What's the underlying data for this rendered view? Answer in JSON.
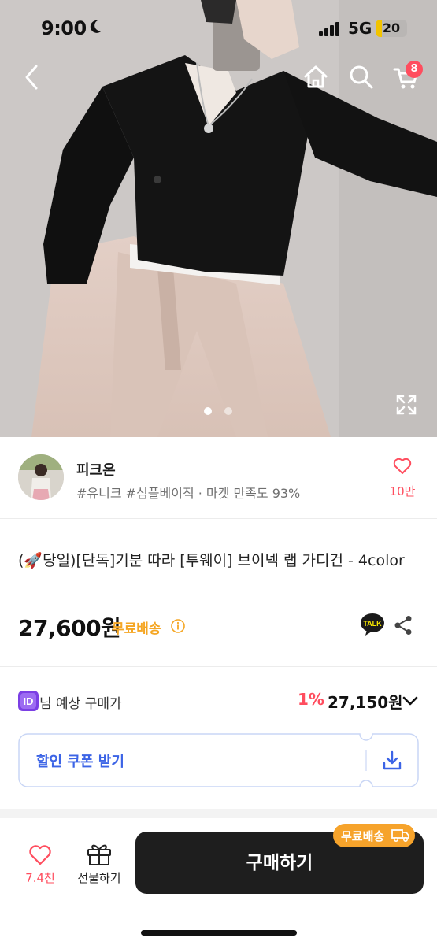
{
  "status_bar": {
    "time": "9:00",
    "network": "5G",
    "battery": "20",
    "battery_level": 0.2
  },
  "top_nav": {
    "cart_badge": "8"
  },
  "gallery": {
    "image_count": 2,
    "active_index": 0
  },
  "seller": {
    "name": "피크온",
    "tags": "#유니크 #심플베이직 · 마켓 만족도 93%",
    "likes": "10만"
  },
  "product": {
    "title": "(🚀당일)[단독]기분 따라 [투웨이] 브이넥 랩 가디건 - 4color",
    "price": "27,600원",
    "free_shipping": "무료배송"
  },
  "member_price": {
    "badge": "ID",
    "label": "님 예상 구매가",
    "discount_rate": "1%",
    "price": "27,150원"
  },
  "coupon": {
    "label": "할인 쿠폰 받기"
  },
  "bottom_bar": {
    "wish_count": "7.4천",
    "gift_label": "선물하기",
    "buy_label": "구매하기",
    "shipping_pill": "무료배송"
  },
  "colors": {
    "accent_red": "#ff4d5e",
    "shipping_orange": "#f5a623",
    "coupon_blue": "#3c64e6",
    "member_purple": "#7b3fe4",
    "buy_button": "#1e1e1e"
  }
}
